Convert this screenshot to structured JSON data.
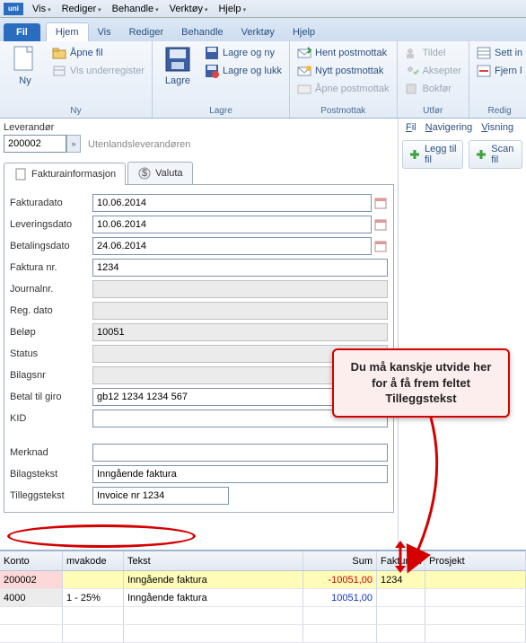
{
  "topmenu": {
    "items": [
      "Vis",
      "Rediger",
      "Behandle",
      "Verktøy",
      "Hjelp"
    ],
    "logo": "uni"
  },
  "tabs": {
    "file": "Fil",
    "items": [
      "Hjem",
      "Vis",
      "Rediger",
      "Behandle",
      "Verktøy",
      "Hjelp"
    ]
  },
  "ribbon": {
    "ny": {
      "label": "Ny",
      "big": "Ny",
      "apne": "Åpne fil",
      "under": "Vis underregister"
    },
    "lagre": {
      "label": "Lagre",
      "big": "Lagre",
      "ny": "Lagre og ny",
      "lukk": "Lagre og lukk"
    },
    "post": {
      "label": "Postmottak",
      "hent": "Hent postmottak",
      "nytt": "Nytt postmottak",
      "apne": "Åpne postmottak"
    },
    "utfor": {
      "label": "Utfør",
      "tildel": "Tildel",
      "aksepter": "Aksepter",
      "bokfor": "Bokfør"
    },
    "redig": {
      "label": "Redig",
      "sett": "Sett in",
      "fjern": "Fjern l"
    }
  },
  "supplier": {
    "label": "Leverandør",
    "code": "200002",
    "name": "Utenlandsleverandøren"
  },
  "doctabs": {
    "info": "Fakturainformasjon",
    "valuta": "Valuta"
  },
  "form": {
    "fakturadato": {
      "label": "Fakturadato",
      "value": "10.06.2014"
    },
    "leveringsdato": {
      "label": "Leveringsdato",
      "value": "10.06.2014"
    },
    "betalingsdato": {
      "label": "Betalingsdato",
      "value": "24.06.2014"
    },
    "fakturanr": {
      "label": "Faktura nr.",
      "value": "1234"
    },
    "journalnr": {
      "label": "Journalnr.",
      "value": ""
    },
    "regdato": {
      "label": "Reg. dato",
      "value": ""
    },
    "belop": {
      "label": "Beløp",
      "value": "10051"
    },
    "status": {
      "label": "Status",
      "value": ""
    },
    "bilagsnr": {
      "label": "Bilagsnr",
      "value": ""
    },
    "betaltil": {
      "label": "Betal til giro",
      "value": "gb12 1234 1234 567"
    },
    "kid": {
      "label": "KID",
      "value": ""
    },
    "merknad": {
      "label": "Merknad",
      "value": ""
    },
    "bilagstekst": {
      "label": "Bilagstekst",
      "value": "Inngående faktura"
    },
    "tilleggstekst": {
      "label": "Tilleggstekst",
      "value": "Invoice nr 1234"
    }
  },
  "rightmenu": {
    "fil": "Fil",
    "nav": "Navigering",
    "vis": "Visning"
  },
  "rightbtns": {
    "legg": "Legg til fil",
    "scan": "Scan fil"
  },
  "callout": "Du må kanskje utvide her for å få frem feltet Tilleggstekst",
  "grid": {
    "headers": {
      "konto": "Konto",
      "mva": "mvakode",
      "tekst": "Tekst",
      "sum": "Sum",
      "faktnr": "Fakturanr",
      "prosjekt": "Prosjekt"
    },
    "rows": [
      {
        "konto": "200002",
        "mva": "",
        "tekst": "Inngående faktura",
        "sum": "-10051,00",
        "faktnr": "1234",
        "cls": "row-yellow row-pink",
        "sumcls": "sum-red"
      },
      {
        "konto": "4000",
        "mva": "1 - 25%",
        "tekst": "Inngående faktura",
        "sum": "10051,00",
        "faktnr": "",
        "cls": "row-gray",
        "sumcls": "sum-blue"
      }
    ]
  }
}
